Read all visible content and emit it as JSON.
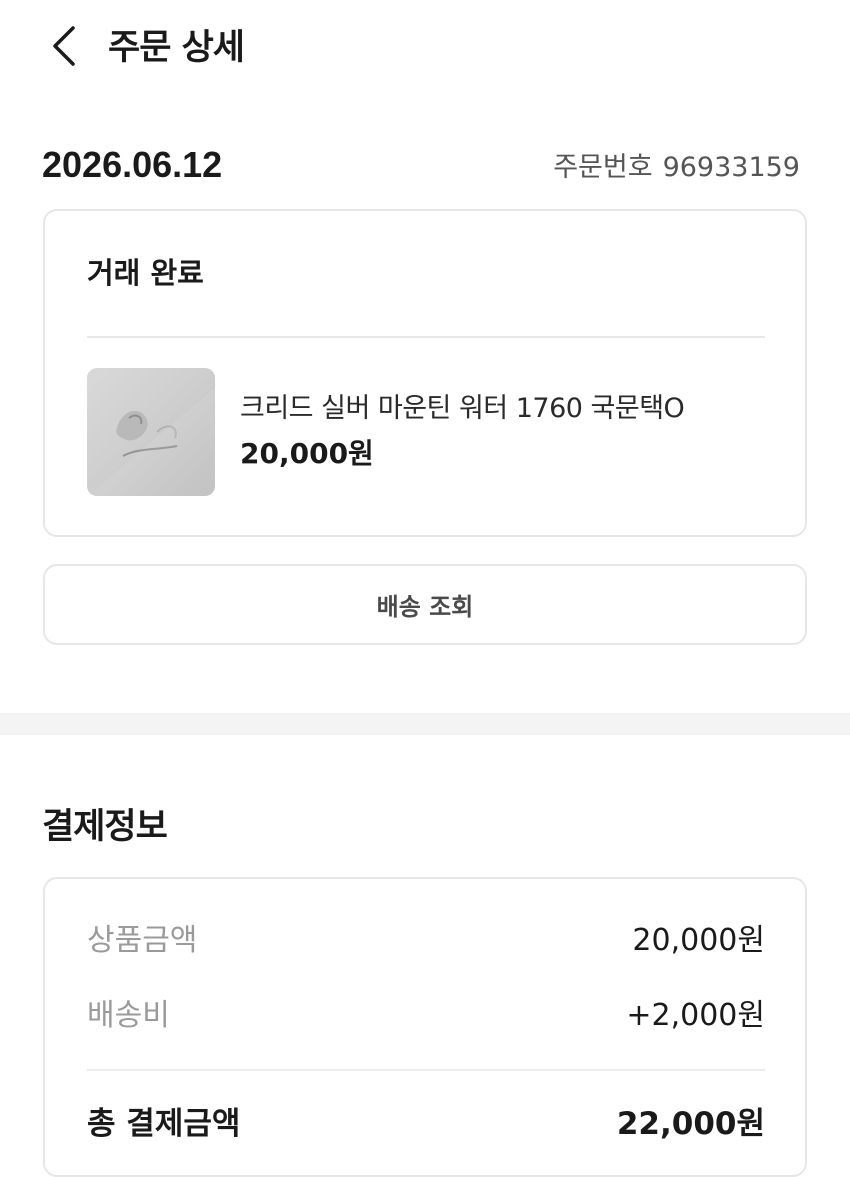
{
  "header": {
    "back_icon": "chevron-left-icon",
    "title": "주문 상세"
  },
  "order": {
    "date": "2026.06.12",
    "number_label": "주문번호",
    "number": "96933159"
  },
  "status_card": {
    "status": "거래 완료",
    "product": {
      "name": "크리드 실버 마운틴 워터 1760 국문택O",
      "price": "20,000원"
    }
  },
  "track_button": {
    "label": "배송 조회"
  },
  "payment": {
    "title": "결제정보",
    "rows": [
      {
        "label": "상품금액",
        "value": "20,000원"
      },
      {
        "label": "배송비",
        "value": "+2,000원"
      }
    ],
    "total": {
      "label": "총 결제금액",
      "value": "22,000원"
    }
  }
}
